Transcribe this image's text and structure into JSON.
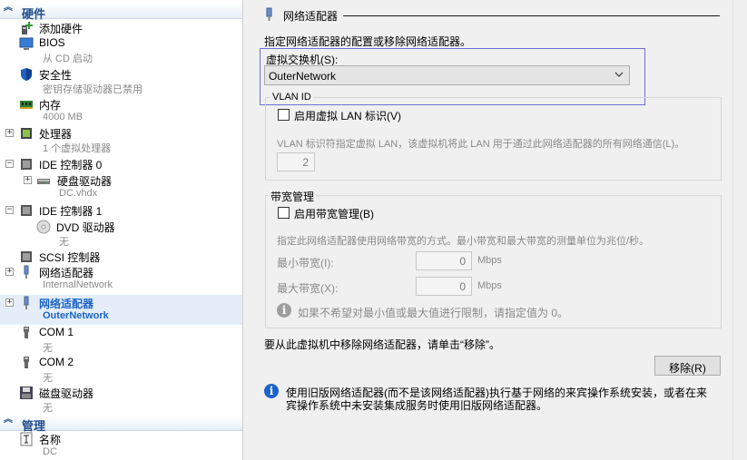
{
  "sidebar": {
    "hardware_header": "硬件",
    "management_header": "管理",
    "items": [
      {
        "label": "添加硬件",
        "sub": ""
      },
      {
        "label": "BIOS",
        "sub": "从 CD 启动"
      },
      {
        "label": "安全性",
        "sub": "密钥存储驱动器已禁用"
      },
      {
        "label": "内存",
        "sub": "4000 MB"
      },
      {
        "label": "处理器",
        "sub": "1 个虚拟处理器"
      },
      {
        "label": "IDE 控制器 0",
        "sub": ""
      },
      {
        "label": "硬盘驱动器",
        "sub": "DC.vhdx"
      },
      {
        "label": "IDE 控制器 1",
        "sub": ""
      },
      {
        "label": "DVD 驱动器",
        "sub": "无"
      },
      {
        "label": "SCSI 控制器",
        "sub": ""
      },
      {
        "label": "网络适配器",
        "sub": "InternalNetwork"
      },
      {
        "label": "网络适配器",
        "sub": "OuterNetwork"
      },
      {
        "label": "COM 1",
        "sub": "无"
      },
      {
        "label": "COM 2",
        "sub": "无"
      },
      {
        "label": "磁盘驱动器",
        "sub": "无"
      },
      {
        "label": "名称",
        "sub": "DC"
      }
    ],
    "expanders": {
      "plus": "+",
      "minus": "−"
    }
  },
  "panel": {
    "title": "网络适配器",
    "description": "指定网络适配器的配置或移除网络适配器。",
    "switch_label": "虚拟交换机(S):",
    "switch_value": "OuterNetwork",
    "vlan": {
      "group_title": "VLAN ID",
      "checkbox_label": "启用虚拟 LAN 标识(V)",
      "description": "VLAN 标识符指定虚拟 LAN，该虚拟机将此 LAN 用于通过此网络适配器的所有网络通信(L)。",
      "value": "2"
    },
    "bandwidth": {
      "group_title": "带宽管理",
      "checkbox_label": "启用带宽管理(B)",
      "description": "指定此网络适配器使用网络带宽的方式。最小带宽和最大带宽的测量单位为兆位/秒。",
      "min_label": "最小带宽(I):",
      "min_value": "0",
      "max_label": "最大带宽(X):",
      "max_value": "0",
      "unit": "Mbps",
      "info": "如果不希望对最小值或最大值进行限制，请指定值为 0。"
    },
    "remove_text": "要从此虚拟机中移除网络适配器，请单击“移除”。",
    "remove_button": "移除(R)",
    "legacy_info_line1": "使用旧版网络适配器(而不是该网络适配器)执行基于网络的来宾操作系统安装，或者在来",
    "legacy_info_line2": "宾操作系统中未安装集成服务时使用旧版网络适配器。"
  },
  "colors": {
    "accent": "#1c64c8",
    "focus_border": "#6f6fd8",
    "header_text": "#1f4e8c",
    "disabled_text": "#8a8a8a"
  }
}
